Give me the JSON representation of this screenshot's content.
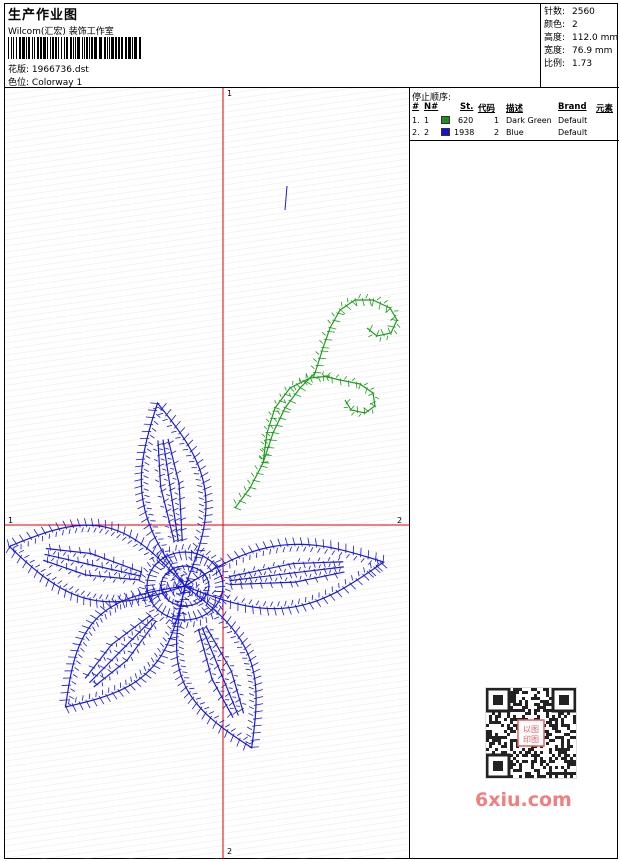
{
  "header": {
    "title": "生产作业图",
    "company": "Wilcom(汇宏) 装饰工作室",
    "design_label": "花版:",
    "design_value": "1966736.dst",
    "colorway_label": "色位:",
    "colorway_value": "Colorway 1"
  },
  "stats": [
    {
      "label": "针数:",
      "value": "2560"
    },
    {
      "label": "颜色:",
      "value": "2"
    },
    {
      "label": "高度:",
      "value": "112.0 mm"
    },
    {
      "label": "宽度:",
      "value": "76.9 mm"
    },
    {
      "label": "比例:",
      "value": "1.73"
    }
  ],
  "stop_sequence": {
    "title": "停止顺序:",
    "columns": [
      "#",
      "N#",
      "St.",
      "代码",
      "描述",
      "Brand",
      "元素"
    ],
    "rows": [
      {
        "index": "1.",
        "needle": "1",
        "stitches": "620",
        "code": "1",
        "description": "Dark Green",
        "brand": "Default",
        "color": "#1a8f1a"
      },
      {
        "index": "2.",
        "needle": "2",
        "stitches": "1938",
        "code": "2",
        "description": "Blue",
        "brand": "Default",
        "color": "#1414d6"
      }
    ]
  },
  "canvas": {
    "axis_labels": {
      "top": "1",
      "bottom": "2",
      "left": "1",
      "right": "2"
    },
    "colors": {
      "axis": "#e00000",
      "blue_thread": "#1a1ad8",
      "green_thread": "#1e9a1e"
    }
  },
  "watermark": {
    "text": "6xiu.com",
    "stamp_text": "以图印图"
  }
}
